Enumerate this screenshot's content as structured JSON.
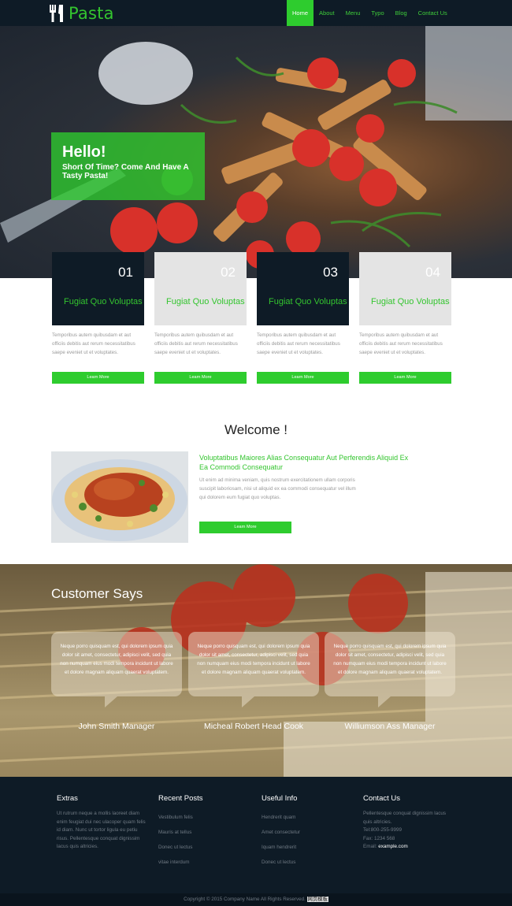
{
  "brand": {
    "name": "Pasta",
    "icon": "fork-knife-icon",
    "accent": "#2ecc2e",
    "dark": "#0e1b26"
  },
  "nav": {
    "items": [
      "Home",
      "About",
      "Menu",
      "Typo",
      "Blog",
      "Contact Us"
    ],
    "active": "Home"
  },
  "hero": {
    "title": "Hello!",
    "subtitle": "Short Of Time? Come And Have A Tasty Pasta!"
  },
  "features": [
    {
      "number": "01",
      "title": "Fugiat Quo Voluptas",
      "text": "Temporibus autem quibusdam et aut officiis debitis aut rerum necessitatibus saepe eveniet ut et voluptates.",
      "button": "Learn More"
    },
    {
      "number": "02",
      "title": "Fugiat Quo Voluptas",
      "text": "Temporibus autem quibusdam et aut officiis debitis aut rerum necessitatibus saepe eveniet ut et voluptates.",
      "button": "Learn More"
    },
    {
      "number": "03",
      "title": "Fugiat Quo Voluptas",
      "text": "Temporibus autem quibusdam et aut officiis debitis aut rerum necessitatibus saepe eveniet ut et voluptates.",
      "button": "Learn More"
    },
    {
      "number": "04",
      "title": "Fugiat Quo Voluptas",
      "text": "Temporibus autem quibusdam et aut officiis debitis aut rerum necessitatibus saepe eveniet ut et voluptates.",
      "button": "Learn More"
    }
  ],
  "welcome": {
    "title": "Welcome !",
    "heading": "Voluptatibus Maiores Alias Consequatur Aut Perferendis Aliquid Ex Ea Commodi Consequatur",
    "text": "Ut enim ad minima veniam, quis nostrum exercitationem ullam corporis suscipit laboriosam, nisi ut aliquid ex ea commodi consequatur vel illum qui dolorem eum fugiat quo voluptas.",
    "button": "Learn More"
  },
  "testimonials": {
    "title": "Customer Says",
    "items": [
      {
        "quote": "Neque porro quisquam est, qui dolorem ipsum quia dolor sit amet, consectetur, adipisci velit, sed quia non numquam eius modi tempora incidunt ut labore et dolore magnam aliquam quaerat voluptatem.",
        "name": "John Smith Manager"
      },
      {
        "quote": "Neque porro quisquam est, qui dolorem ipsum quia dolor sit amet, consectetur, adipisci velit, sed quia non numquam eius modi tempora incidunt ut labore et dolore magnam aliquam quaerat voluptatem.",
        "name": "Micheal Robert Head Cook"
      },
      {
        "quote": "Neque porro quisquam est, qui dolorem ipsum quia dolor sit amet, consectetur, adipisci velit, sed quia non numquam eius modi tempora incidunt ut labore et dolore magnam aliquam quaerat voluptatem.",
        "name": "Williumson Ass Manager"
      }
    ]
  },
  "footer": {
    "extras": {
      "title": "Extras",
      "text": "Ut rutrum neque a mollis laoreet diam enim feugiat dui nec ulacoper quam felis id diam. Nunc ut tortor ligula eu petiu risus. Pellentesque conquat dignissim lacus quis altricies."
    },
    "recent_posts": {
      "title": "Recent Posts",
      "links": [
        "Vestibulum felis",
        "Mauris at tellus",
        "Donec ut lectus",
        "vitae interdum"
      ]
    },
    "useful_info": {
      "title": "Useful Info",
      "links": [
        "Hendrerit quam",
        "Amet consectetur",
        "Iquam hendrerit",
        "Donec ut lectus"
      ]
    },
    "contact": {
      "title": "Contact Us",
      "text": "Pellentesque conquat dignissim lacus quis altricies.",
      "tel": "Tel:800-255-9999",
      "fax": "Fax: 1234 568",
      "email_label": "Email:",
      "email": "example.com"
    }
  },
  "copyright": {
    "text": "Copyright © 2015 Company Name All Rights Reserved.",
    "highlight": "网页模板"
  }
}
